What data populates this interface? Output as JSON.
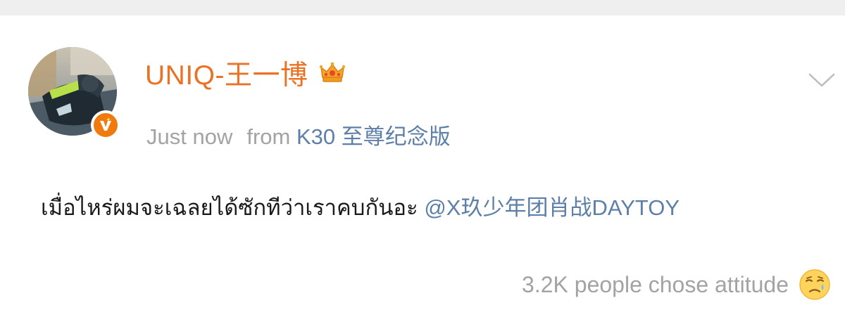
{
  "post": {
    "username": "UNIQ-王一博",
    "timestamp": "Just now",
    "from_label": "from",
    "source": "K30 至尊纪念版",
    "text": "เมื่อไหร่ผมจะเฉลยได้ซักทีว่าเราคบกันอะ",
    "mention": "@X玖少年团肖战DAYTOY",
    "attitude": "3.2K people chose attitude"
  },
  "icons": {
    "crown": "crown-icon",
    "verified": "verified-v-icon",
    "chevron": "chevron-down-icon",
    "emoji": "crying-face-emoji-icon"
  },
  "colors": {
    "username": "#eb7224",
    "link": "#5d7fa8",
    "muted": "#a3a3a3",
    "text": "#1a1a1a",
    "badge": "#f07a0d",
    "top_strip": "#efefef"
  }
}
